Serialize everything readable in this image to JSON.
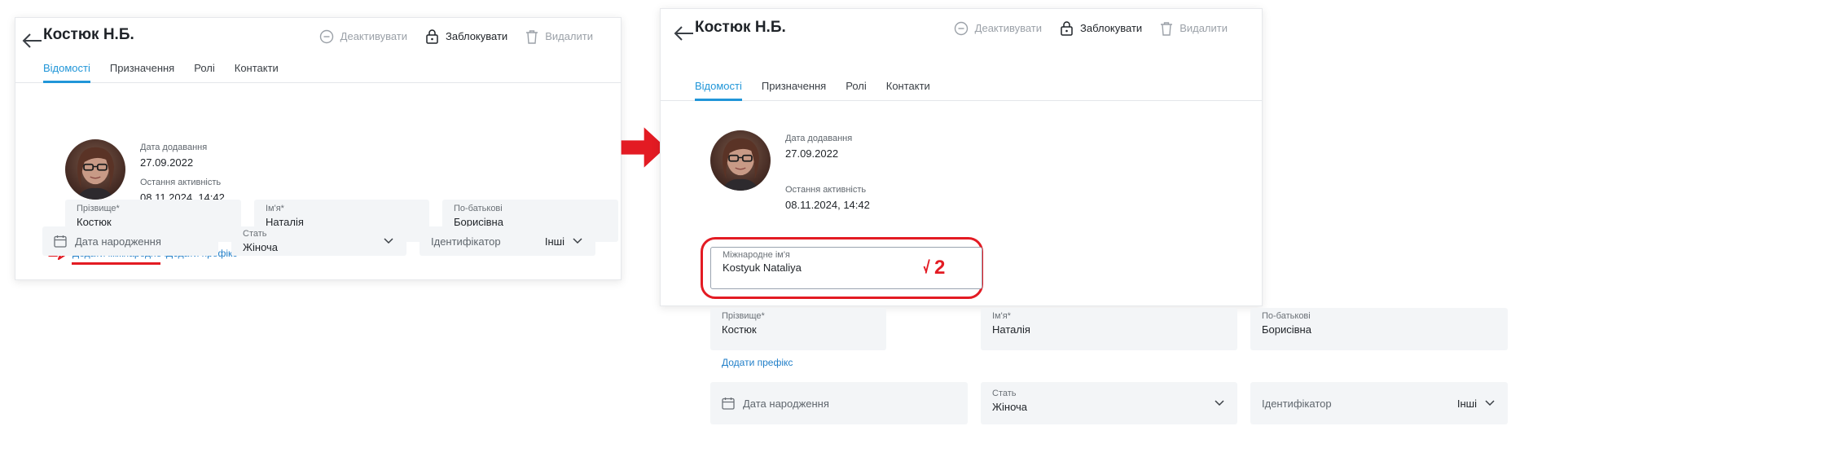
{
  "colors": {
    "accent": "#2196d8",
    "link": "#1f7ec8",
    "annotation": "#e31b23",
    "field_bg": "#f3f5f7"
  },
  "before": {
    "header": {
      "title": "Костюк Н.Б.",
      "actions": [
        {
          "label": "Деактивувати",
          "icon": "minus-circle-icon"
        },
        {
          "label": "Заблокувати",
          "icon": "lock-icon"
        },
        {
          "label": "Видалити",
          "icon": "trash-icon"
        }
      ],
      "tabs": [
        "Відомості",
        "Призначення",
        "Ролі",
        "Контакти"
      ]
    },
    "meta": {
      "added_label": "Дата додавання",
      "added_value": "27.09.2022",
      "activity_label": "Остання активність",
      "activity_value": "08.11.2024, 14:42"
    },
    "fields": {
      "surname": {
        "label": "Прізвище*",
        "value": "Костюк"
      },
      "name": {
        "label": "Ім'я*",
        "value": "Наталія"
      },
      "patronymic": {
        "label": "По-батькові",
        "value": "Борисівна"
      },
      "birthdate_placeholder": "Дата народження",
      "gender": {
        "label": "Стать",
        "value": "Жіноча"
      },
      "identifier_placeholder": "Ідентифікатор",
      "identifier_type": "Інші"
    },
    "links": {
      "add_intl_name": "Додати міжнародне ім'я",
      "add_prefix": "Додати префікс"
    },
    "marker": "1"
  },
  "after": {
    "header": {
      "title": "Костюк Н.Б.",
      "actions": [
        {
          "label": "Деактивувати",
          "icon": "minus-circle-icon"
        },
        {
          "label": "Заблокувати",
          "icon": "lock-icon"
        },
        {
          "label": "Видалити",
          "icon": "trash-icon"
        }
      ],
      "tabs": [
        "Відомості",
        "Призначення",
        "Ролі",
        "Контакти"
      ]
    },
    "meta": {
      "added_label": "Дата додавання",
      "added_value": "27.09.2022",
      "activity_label": "Остання активність",
      "activity_value": "08.11.2024, 14:42"
    },
    "intl_name": {
      "label": "Міжнародне ім'я",
      "value": "Kostyuk Nataliya"
    },
    "fields": {
      "surname": {
        "label": "Прізвище*",
        "value": "Костюк"
      },
      "name": {
        "label": "Ім'я*",
        "value": "Наталія"
      },
      "patronymic": {
        "label": "По-батькові",
        "value": "Борисівна"
      },
      "birthdate_placeholder": "Дата народження",
      "gender": {
        "label": "Стать",
        "value": "Жіноча"
      },
      "identifier_placeholder": "Ідентифікатор",
      "identifier_type": "Інші"
    },
    "links": {
      "add_prefix": "Додати префікс"
    },
    "marker": "2"
  }
}
